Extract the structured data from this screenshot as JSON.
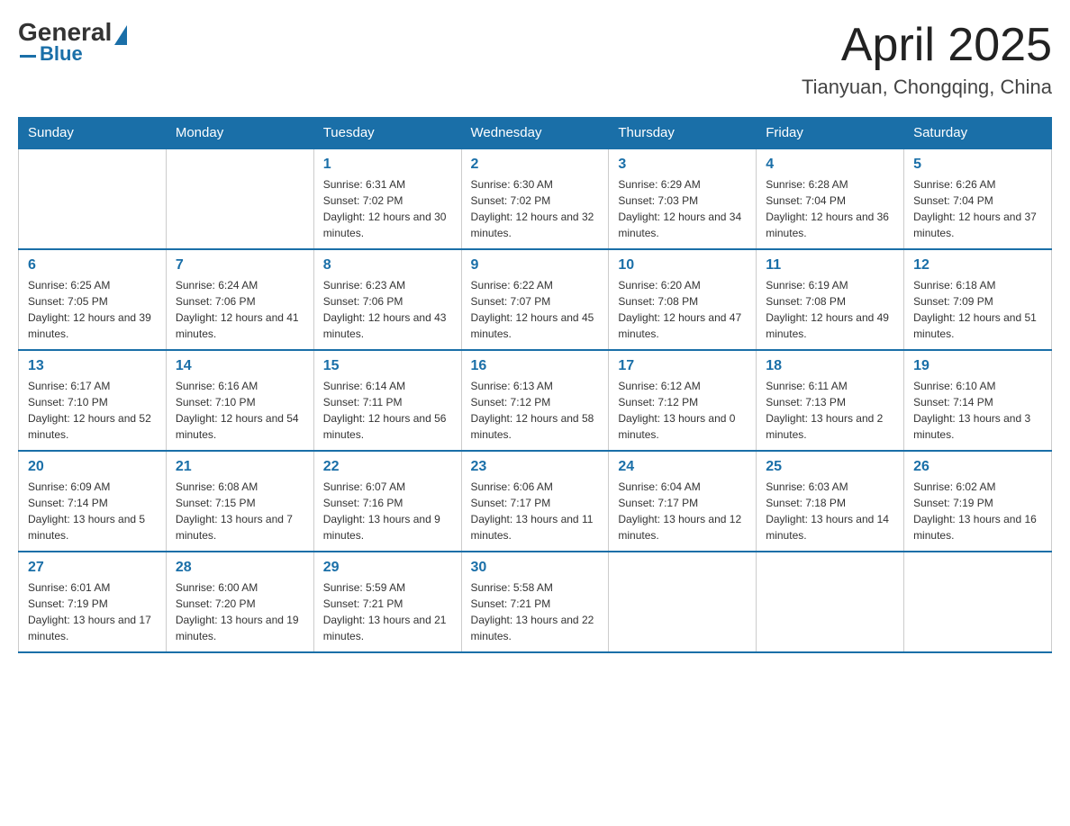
{
  "logo": {
    "general": "General",
    "blue": "Blue"
  },
  "title": {
    "month_year": "April 2025",
    "location": "Tianyuan, Chongqing, China"
  },
  "headers": [
    "Sunday",
    "Monday",
    "Tuesday",
    "Wednesday",
    "Thursday",
    "Friday",
    "Saturday"
  ],
  "weeks": [
    [
      {
        "day": "",
        "sunrise": "",
        "sunset": "",
        "daylight": ""
      },
      {
        "day": "",
        "sunrise": "",
        "sunset": "",
        "daylight": ""
      },
      {
        "day": "1",
        "sunrise": "Sunrise: 6:31 AM",
        "sunset": "Sunset: 7:02 PM",
        "daylight": "Daylight: 12 hours and 30 minutes."
      },
      {
        "day": "2",
        "sunrise": "Sunrise: 6:30 AM",
        "sunset": "Sunset: 7:02 PM",
        "daylight": "Daylight: 12 hours and 32 minutes."
      },
      {
        "day": "3",
        "sunrise": "Sunrise: 6:29 AM",
        "sunset": "Sunset: 7:03 PM",
        "daylight": "Daylight: 12 hours and 34 minutes."
      },
      {
        "day": "4",
        "sunrise": "Sunrise: 6:28 AM",
        "sunset": "Sunset: 7:04 PM",
        "daylight": "Daylight: 12 hours and 36 minutes."
      },
      {
        "day": "5",
        "sunrise": "Sunrise: 6:26 AM",
        "sunset": "Sunset: 7:04 PM",
        "daylight": "Daylight: 12 hours and 37 minutes."
      }
    ],
    [
      {
        "day": "6",
        "sunrise": "Sunrise: 6:25 AM",
        "sunset": "Sunset: 7:05 PM",
        "daylight": "Daylight: 12 hours and 39 minutes."
      },
      {
        "day": "7",
        "sunrise": "Sunrise: 6:24 AM",
        "sunset": "Sunset: 7:06 PM",
        "daylight": "Daylight: 12 hours and 41 minutes."
      },
      {
        "day": "8",
        "sunrise": "Sunrise: 6:23 AM",
        "sunset": "Sunset: 7:06 PM",
        "daylight": "Daylight: 12 hours and 43 minutes."
      },
      {
        "day": "9",
        "sunrise": "Sunrise: 6:22 AM",
        "sunset": "Sunset: 7:07 PM",
        "daylight": "Daylight: 12 hours and 45 minutes."
      },
      {
        "day": "10",
        "sunrise": "Sunrise: 6:20 AM",
        "sunset": "Sunset: 7:08 PM",
        "daylight": "Daylight: 12 hours and 47 minutes."
      },
      {
        "day": "11",
        "sunrise": "Sunrise: 6:19 AM",
        "sunset": "Sunset: 7:08 PM",
        "daylight": "Daylight: 12 hours and 49 minutes."
      },
      {
        "day": "12",
        "sunrise": "Sunrise: 6:18 AM",
        "sunset": "Sunset: 7:09 PM",
        "daylight": "Daylight: 12 hours and 51 minutes."
      }
    ],
    [
      {
        "day": "13",
        "sunrise": "Sunrise: 6:17 AM",
        "sunset": "Sunset: 7:10 PM",
        "daylight": "Daylight: 12 hours and 52 minutes."
      },
      {
        "day": "14",
        "sunrise": "Sunrise: 6:16 AM",
        "sunset": "Sunset: 7:10 PM",
        "daylight": "Daylight: 12 hours and 54 minutes."
      },
      {
        "day": "15",
        "sunrise": "Sunrise: 6:14 AM",
        "sunset": "Sunset: 7:11 PM",
        "daylight": "Daylight: 12 hours and 56 minutes."
      },
      {
        "day": "16",
        "sunrise": "Sunrise: 6:13 AM",
        "sunset": "Sunset: 7:12 PM",
        "daylight": "Daylight: 12 hours and 58 minutes."
      },
      {
        "day": "17",
        "sunrise": "Sunrise: 6:12 AM",
        "sunset": "Sunset: 7:12 PM",
        "daylight": "Daylight: 13 hours and 0 minutes."
      },
      {
        "day": "18",
        "sunrise": "Sunrise: 6:11 AM",
        "sunset": "Sunset: 7:13 PM",
        "daylight": "Daylight: 13 hours and 2 minutes."
      },
      {
        "day": "19",
        "sunrise": "Sunrise: 6:10 AM",
        "sunset": "Sunset: 7:14 PM",
        "daylight": "Daylight: 13 hours and 3 minutes."
      }
    ],
    [
      {
        "day": "20",
        "sunrise": "Sunrise: 6:09 AM",
        "sunset": "Sunset: 7:14 PM",
        "daylight": "Daylight: 13 hours and 5 minutes."
      },
      {
        "day": "21",
        "sunrise": "Sunrise: 6:08 AM",
        "sunset": "Sunset: 7:15 PM",
        "daylight": "Daylight: 13 hours and 7 minutes."
      },
      {
        "day": "22",
        "sunrise": "Sunrise: 6:07 AM",
        "sunset": "Sunset: 7:16 PM",
        "daylight": "Daylight: 13 hours and 9 minutes."
      },
      {
        "day": "23",
        "sunrise": "Sunrise: 6:06 AM",
        "sunset": "Sunset: 7:17 PM",
        "daylight": "Daylight: 13 hours and 11 minutes."
      },
      {
        "day": "24",
        "sunrise": "Sunrise: 6:04 AM",
        "sunset": "Sunset: 7:17 PM",
        "daylight": "Daylight: 13 hours and 12 minutes."
      },
      {
        "day": "25",
        "sunrise": "Sunrise: 6:03 AM",
        "sunset": "Sunset: 7:18 PM",
        "daylight": "Daylight: 13 hours and 14 minutes."
      },
      {
        "day": "26",
        "sunrise": "Sunrise: 6:02 AM",
        "sunset": "Sunset: 7:19 PM",
        "daylight": "Daylight: 13 hours and 16 minutes."
      }
    ],
    [
      {
        "day": "27",
        "sunrise": "Sunrise: 6:01 AM",
        "sunset": "Sunset: 7:19 PM",
        "daylight": "Daylight: 13 hours and 17 minutes."
      },
      {
        "day": "28",
        "sunrise": "Sunrise: 6:00 AM",
        "sunset": "Sunset: 7:20 PM",
        "daylight": "Daylight: 13 hours and 19 minutes."
      },
      {
        "day": "29",
        "sunrise": "Sunrise: 5:59 AM",
        "sunset": "Sunset: 7:21 PM",
        "daylight": "Daylight: 13 hours and 21 minutes."
      },
      {
        "day": "30",
        "sunrise": "Sunrise: 5:58 AM",
        "sunset": "Sunset: 7:21 PM",
        "daylight": "Daylight: 13 hours and 22 minutes."
      },
      {
        "day": "",
        "sunrise": "",
        "sunset": "",
        "daylight": ""
      },
      {
        "day": "",
        "sunrise": "",
        "sunset": "",
        "daylight": ""
      },
      {
        "day": "",
        "sunrise": "",
        "sunset": "",
        "daylight": ""
      }
    ]
  ]
}
